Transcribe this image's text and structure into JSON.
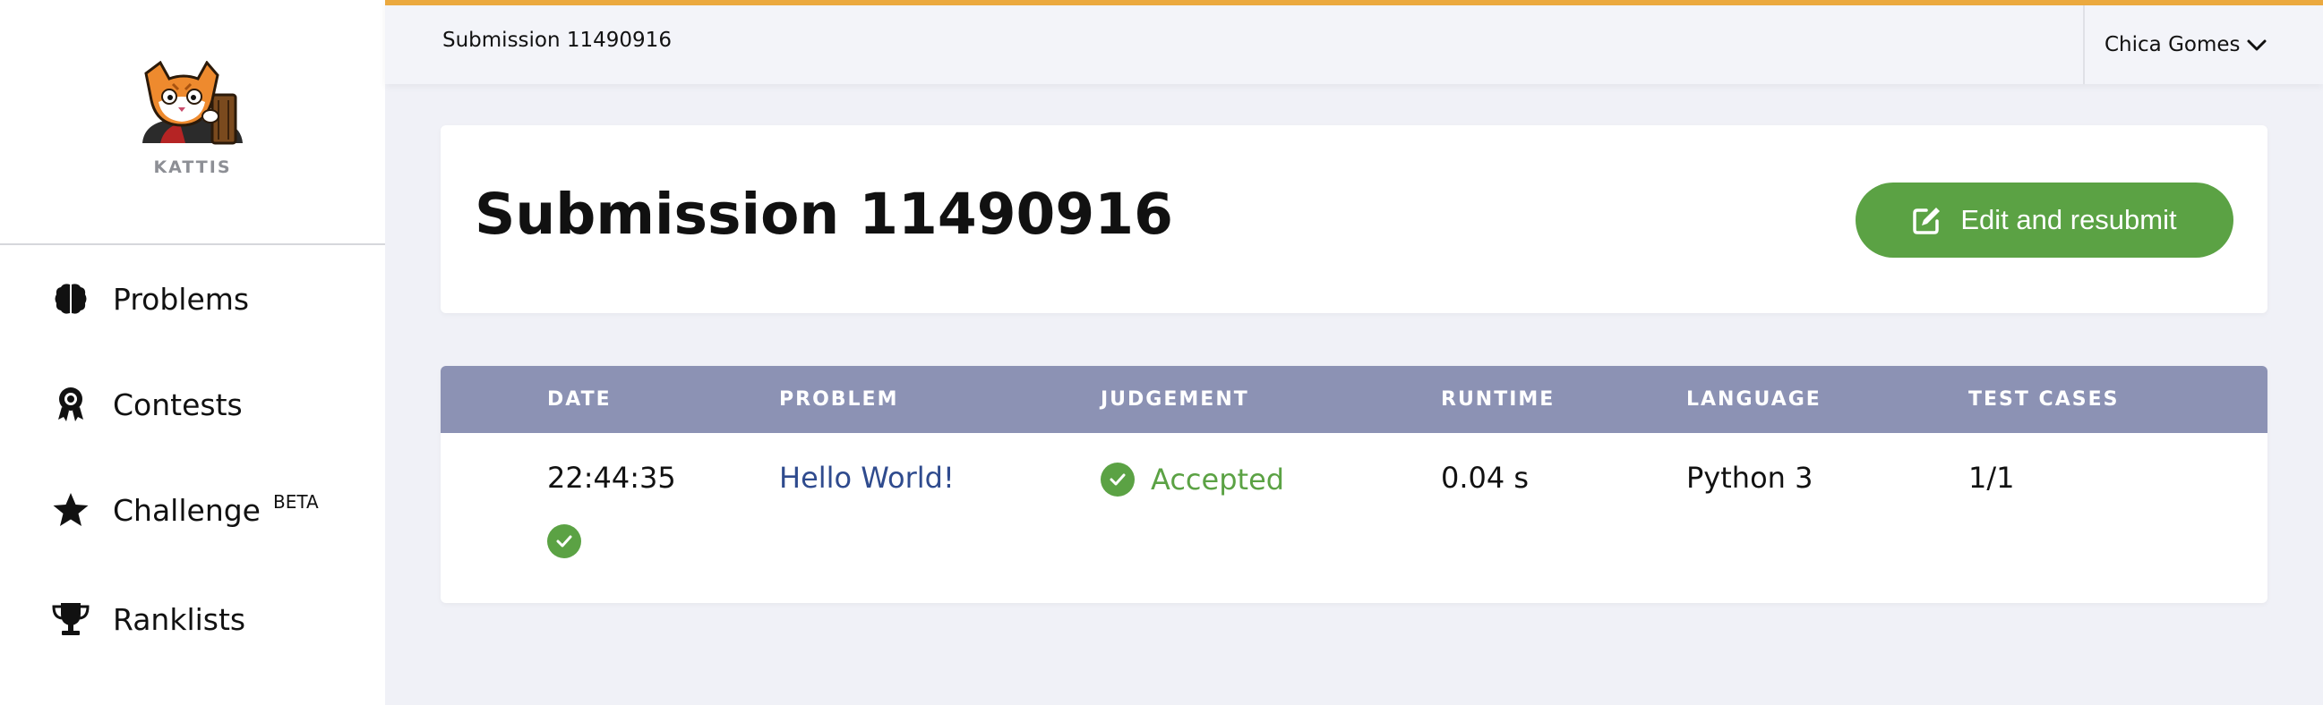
{
  "brand": {
    "name": "KATTIS"
  },
  "nav": [
    {
      "label": "Problems",
      "icon": "brain-icon"
    },
    {
      "label": "Contests",
      "icon": "award-icon"
    },
    {
      "label": "Challenge",
      "badge": "BETA",
      "icon": "star-icon"
    },
    {
      "label": "Ranklists",
      "icon": "trophy-icon"
    }
  ],
  "topbar": {
    "breadcrumb": "Submission 11490916",
    "user_name": "Chica Gomes"
  },
  "header": {
    "title": "Submission 11490916",
    "resubmit_label": "Edit and resubmit"
  },
  "table": {
    "columns": [
      "DATE",
      "PROBLEM",
      "JUDGEMENT",
      "RUNTIME",
      "LANGUAGE",
      "TEST CASES"
    ],
    "row": {
      "date": "22:44:35",
      "problem": "Hello World!",
      "judgement": "Accepted",
      "runtime": "0.04 s",
      "language": "Python 3",
      "test_cases": "1/1"
    }
  },
  "colors": {
    "accent_top": "#eba93f",
    "success": "#5ba244",
    "table_header": "#8c92b4",
    "link": "#2f4b8e"
  }
}
